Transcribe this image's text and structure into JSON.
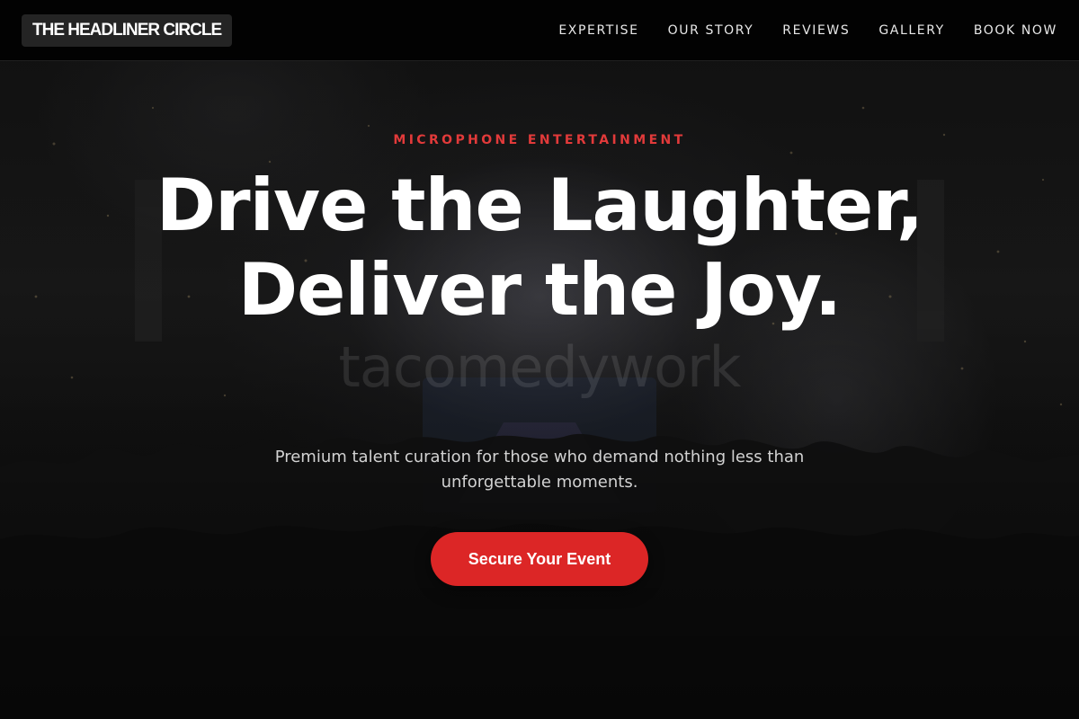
{
  "brand": {
    "name": "THE HEADLINER CIRCLE"
  },
  "nav": {
    "items": [
      {
        "label": "EXPERTISE"
      },
      {
        "label": "OUR STORY"
      },
      {
        "label": "REVIEWS"
      },
      {
        "label": "GALLERY"
      },
      {
        "label": "BOOK NOW"
      }
    ]
  },
  "hero": {
    "eyebrow": "MICROPHONE ENTERTAINMENT",
    "headline": "Drive the Laughter, Deliver the Joy.",
    "subtitle": "Premium talent curation for those who demand nothing less than unforgettable moments.",
    "cta_label": "Secure Your Event",
    "background_text": "tacomedywork"
  },
  "colors": {
    "accent": "#dc2626",
    "eyebrow": "#e23a3a",
    "background": "#0a0a0a",
    "text": "#ffffff"
  }
}
